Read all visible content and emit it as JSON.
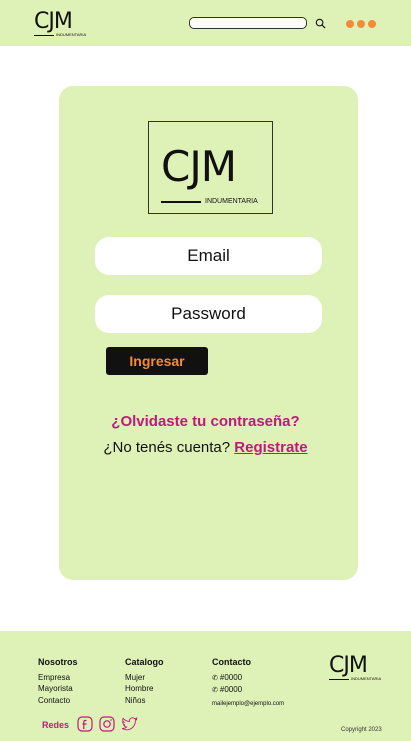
{
  "header": {
    "logo_big": "CJM",
    "logo_small": "INDUMENTARIA",
    "search": {
      "placeholder": ""
    }
  },
  "login": {
    "logo_big": "CJM",
    "logo_small": "INDUMENTARIA",
    "email_placeholder": "Email",
    "password_placeholder": "Password",
    "submit_label": "Ingresar",
    "forgot_label": "¿Olvidaste tu contraseña?",
    "no_account_text": "¿No tenés cuenta?",
    "register_label": "Registrate"
  },
  "footer": {
    "columns": [
      {
        "title": "Nosotros",
        "items": [
          "Empresa",
          "Mayorista",
          "Contacto"
        ]
      },
      {
        "title": "Catalogo",
        "items": [
          "Mujer",
          "Hombre",
          "Niños"
        ]
      }
    ],
    "contact": {
      "title": "Contacto",
      "phone1": "#0000",
      "phone2": "#0000",
      "email": "mailejemplo@ejemplo.com"
    },
    "logo_big": "CJM",
    "logo_small": "INDUMENTARIA",
    "redes_label": "Redes",
    "copyright": "Copyright 2023"
  },
  "colors": {
    "panel_bg": "#def2b8",
    "accent_orange": "#f28c3a",
    "accent_magenta": "#c2187a"
  }
}
